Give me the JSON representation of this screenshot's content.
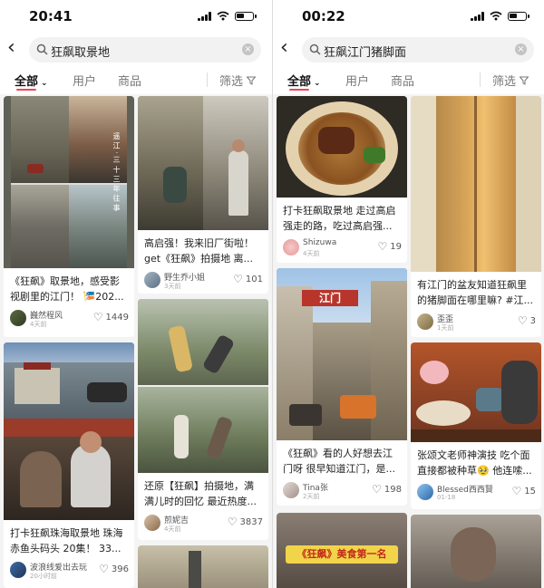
{
  "screens": [
    {
      "status_time": "20:41",
      "search_query": "狂飙取景地",
      "tabs": [
        "全部",
        "用户",
        "商品"
      ],
      "filter_label": "筛选",
      "cards": [
        {
          "title": "《狂飙》取景地，感受影视剧里的江门！ 🎏202...",
          "user": "巍然程风",
          "date": "4天前",
          "likes": "1449",
          "overlay_text": "遥 江 · 三 十 三 年 往 事"
        },
        {
          "title": "高启强！我来旧厂街啦！get《狂飙》拍摄地 离...",
          "user": "野生乔小姐",
          "date": "3天前",
          "likes": "101"
        },
        {
          "title": "打卡狂飙珠海取景地 珠海赤鱼头码头 20集！ 33...",
          "user": "波浪线爱出去玩",
          "date": "20小时前",
          "likes": "396"
        },
        {
          "title": "还原【狂飙】拍摄地，满满儿时的回忆 最近热度...",
          "user": "煎妮吉",
          "date": "4天前",
          "likes": "3837"
        }
      ]
    },
    {
      "status_time": "00:22",
      "search_query": "狂飙江门猪脚面",
      "tabs": [
        "全部",
        "用户",
        "商品"
      ],
      "filter_label": "筛选",
      "cards": [
        {
          "title": "打卡狂飙取景地 走过高启强走的路，吃过高启强...",
          "user": "Shizuwa",
          "date": "4天前",
          "likes": "19"
        },
        {
          "title": "有江门的盆友知道狂飙里的猪脚面在哪里嘛? #江...",
          "user": "歪歪",
          "date": "1天前",
          "likes": "3"
        },
        {
          "title": "《狂飙》看的人好想去江门呀 很早知道江门，是...",
          "user": "Tina张",
          "date": "2天前",
          "likes": "198",
          "sign_text": "江门"
        },
        {
          "title": "张颂文老师神演技 吃个面直接都被种草🥹 他连嗦...",
          "user": "Blessed西西賢",
          "date": "01-18",
          "likes": "15"
        },
        {
          "banner_text": "《狂飙》美食第一名"
        }
      ]
    }
  ],
  "icons": {
    "back": "chevron-left-icon",
    "search": "search-icon",
    "clear": "clear-icon",
    "filter": "filter-icon",
    "like": "heart-icon",
    "dropdown": "chevron-down-icon"
  },
  "colors": {
    "accent": "#f04455"
  }
}
